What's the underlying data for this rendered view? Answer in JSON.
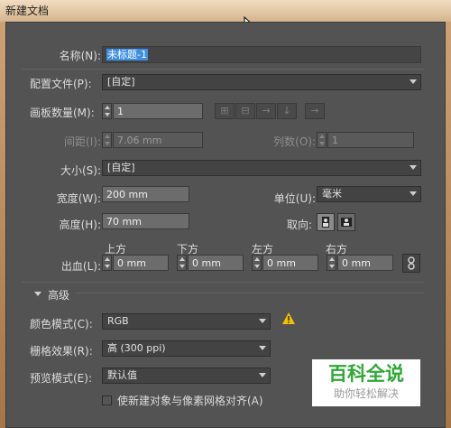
{
  "window": {
    "title": "新建文档"
  },
  "name": {
    "label": "名称(N):",
    "value": "未标题-1"
  },
  "profile": {
    "label": "配置文件(P):",
    "value": "[自定]"
  },
  "artboards": {
    "label": "画板数量(M):",
    "value": "1"
  },
  "spacing": {
    "label": "间距(I):",
    "value": "7.06 mm"
  },
  "columns": {
    "label": "列数(O):",
    "value": "1"
  },
  "size": {
    "label": "大小(S):",
    "value": "[自定]"
  },
  "width": {
    "label": "宽度(W):",
    "value": "200 mm"
  },
  "units": {
    "label": "单位(U):",
    "value": "毫米"
  },
  "height": {
    "label": "高度(H):",
    "value": "70 mm"
  },
  "orientation": {
    "label": "取向:",
    "selected": "landscape"
  },
  "bleed": {
    "label": "出血(L):",
    "top_label": "上方",
    "bottom_label": "下方",
    "left_label": "左方",
    "right_label": "右方",
    "top": "0 mm",
    "bottom": "0 mm",
    "left": "0 mm",
    "right": "0 mm"
  },
  "advanced": {
    "label": "高级"
  },
  "color_mode": {
    "label": "颜色模式(C):",
    "value": "RGB"
  },
  "raster_effects": {
    "label": "栅格效果(R):",
    "value": "高 (300 ppi)"
  },
  "preview_mode": {
    "label": "预览模式(E):",
    "value": "默认值"
  },
  "align_pixel": {
    "label": "使新建对象与像素网格对齐(A)",
    "checked": false
  },
  "watermark": {
    "title": "百科全说",
    "subtitle": "助你轻松解决"
  },
  "colors": {
    "panel": "#535353",
    "highlight": "#3d8ee6",
    "warning": "#f2c200",
    "watermark": "#2fa836"
  }
}
